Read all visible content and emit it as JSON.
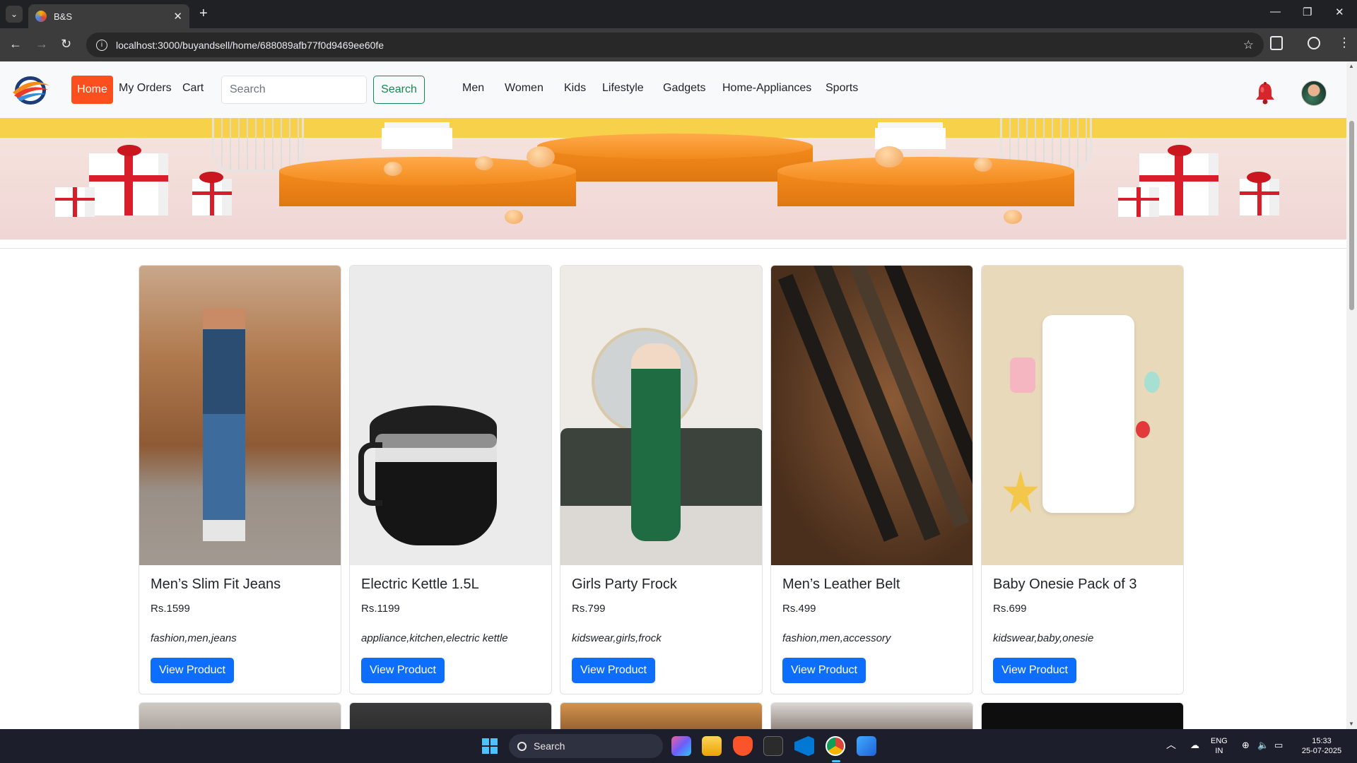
{
  "browser": {
    "tab_title": "B&S",
    "url": "localhost:3000/buyandsell/home/688089afb77f0d9469ee60fe"
  },
  "navbar": {
    "home_label": "Home",
    "my_orders_label": "My Orders",
    "cart_label": "Cart",
    "search_placeholder": "Search",
    "search_button_label": "Search",
    "categories": [
      "Men",
      "Women",
      "Kids",
      "Lifestyle",
      "Gadgets",
      "Home-Appliances",
      "Sports"
    ],
    "accent_color": "#fd4f1e"
  },
  "products": [
    {
      "title": "Men’s Slim Fit Jeans",
      "price": "Rs.1599",
      "tags": "fashion,men,jeans",
      "button": "View Product"
    },
    {
      "title": "Electric Kettle 1.5L",
      "price": "Rs.1199",
      "tags": "appliance,kitchen,electric kettle",
      "button": "View Product"
    },
    {
      "title": "Girls Party Frock",
      "price": "Rs.799",
      "tags": "kidswear,girls,frock",
      "button": "View Product"
    },
    {
      "title": "Men’s Leather Belt",
      "price": "Rs.499",
      "tags": "fashion,men,accessory",
      "button": "View Product"
    },
    {
      "title": "Baby Onesie Pack of 3",
      "price": "Rs.699",
      "tags": "kidswear,baby,onesie",
      "button": "View Product"
    }
  ],
  "taskbar": {
    "search_label": "Search",
    "lang_top": "ENG",
    "lang_bottom": "IN",
    "time": "15:33",
    "date": "25-07-2025"
  }
}
